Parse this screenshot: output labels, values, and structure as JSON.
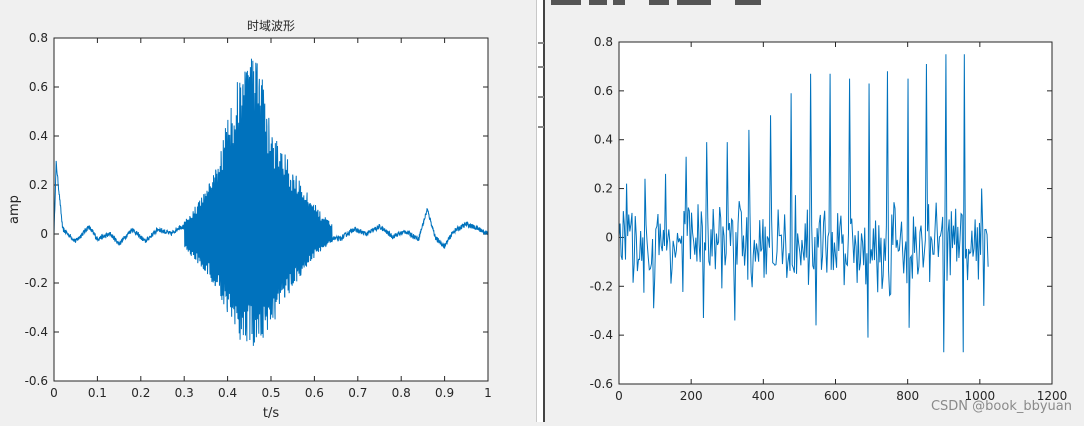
{
  "watermark": "CSDN @book_bbyuan",
  "chart_data": [
    {
      "type": "line",
      "title": "时域波形",
      "xlabel": "t/s",
      "ylabel": "amp",
      "xlim": [
        0,
        1
      ],
      "ylim": [
        -0.6,
        0.8
      ],
      "xticks": [
        0,
        0.1,
        0.2,
        0.3,
        0.4,
        0.5,
        0.6,
        0.7,
        0.8,
        0.9,
        1
      ],
      "yticks": [
        -0.6,
        -0.4,
        -0.2,
        0,
        0.2,
        0.4,
        0.6,
        0.8
      ],
      "xtick_labels": [
        "0",
        "0.1",
        "0.2",
        "0.3",
        "0.4",
        "0.5",
        "0.6",
        "0.7",
        "0.8",
        "0.9",
        "1"
      ],
      "ytick_labels": [
        "-0.6",
        "-0.4",
        "-0.2",
        "0",
        "0.2",
        "0.4",
        "0.6",
        "0.8"
      ],
      "grid": false,
      "color": "#0072bd",
      "envelope": {
        "t": [
          0.3,
          0.32,
          0.35,
          0.38,
          0.4,
          0.42,
          0.44,
          0.46,
          0.48,
          0.5,
          0.52,
          0.55,
          0.58,
          0.61,
          0.64
        ],
        "upper": [
          0.05,
          0.1,
          0.18,
          0.3,
          0.48,
          0.62,
          0.72,
          0.75,
          0.66,
          0.42,
          0.36,
          0.28,
          0.18,
          0.1,
          0.04
        ],
        "lower": [
          -0.05,
          -0.1,
          -0.16,
          -0.24,
          -0.34,
          -0.42,
          -0.46,
          -0.48,
          -0.44,
          -0.38,
          -0.32,
          -0.22,
          -0.14,
          -0.08,
          -0.03
        ]
      },
      "baseline": {
        "t": [
          0.0,
          0.005,
          0.02,
          0.05,
          0.08,
          0.1,
          0.13,
          0.15,
          0.18,
          0.21,
          0.24,
          0.27,
          0.29,
          0.66,
          0.69,
          0.72,
          0.75,
          0.78,
          0.81,
          0.84,
          0.86,
          0.88,
          0.9,
          0.92,
          0.95,
          0.98,
          1.0
        ],
        "y": [
          0.0,
          0.29,
          0.02,
          -0.03,
          0.03,
          -0.02,
          0.0,
          -0.04,
          0.02,
          -0.03,
          0.02,
          0.0,
          0.03,
          -0.02,
          0.02,
          0.0,
          0.03,
          -0.01,
          0.01,
          -0.02,
          0.1,
          -0.02,
          -0.05,
          0.01,
          0.04,
          0.02,
          0.0
        ]
      }
    },
    {
      "type": "line",
      "title": "",
      "xlabel": "",
      "ylabel": "",
      "xlim": [
        0,
        1200
      ],
      "ylim": [
        -0.6,
        0.8
      ],
      "xticks": [
        0,
        200,
        400,
        600,
        800,
        1000,
        1200
      ],
      "yticks": [
        -0.6,
        -0.4,
        -0.2,
        0,
        0.2,
        0.4,
        0.6,
        0.8
      ],
      "xtick_labels": [
        "0",
        "200",
        "400",
        "600",
        "800",
        "1000",
        "1200"
      ],
      "ytick_labels": [
        "-0.6",
        "-0.4",
        "-0.2",
        "0",
        "0.2",
        "0.4",
        "0.6",
        "0.8"
      ],
      "grid": false,
      "color": "#0072bd",
      "n_samples": 1024,
      "peaks": [
        {
          "x": 20,
          "y": 0.22
        },
        {
          "x": 72,
          "y": 0.24
        },
        {
          "x": 128,
          "y": 0.26
        },
        {
          "x": 185,
          "y": 0.33
        },
        {
          "x": 242,
          "y": 0.39
        },
        {
          "x": 300,
          "y": 0.39
        },
        {
          "x": 360,
          "y": 0.44
        },
        {
          "x": 420,
          "y": 0.5
        },
        {
          "x": 476,
          "y": 0.59
        },
        {
          "x": 530,
          "y": 0.67
        },
        {
          "x": 585,
          "y": 0.67
        },
        {
          "x": 640,
          "y": 0.65
        },
        {
          "x": 693,
          "y": 0.63
        },
        {
          "x": 745,
          "y": 0.68
        },
        {
          "x": 800,
          "y": 0.65
        },
        {
          "x": 852,
          "y": 0.71
        },
        {
          "x": 905,
          "y": 0.75
        },
        {
          "x": 958,
          "y": 0.75
        },
        {
          "x": 1005,
          "y": 0.2
        }
      ],
      "troughs": [
        {
          "x": 95,
          "y": -0.29
        },
        {
          "x": 235,
          "y": -0.33
        },
        {
          "x": 320,
          "y": -0.34
        },
        {
          "x": 545,
          "y": -0.36
        },
        {
          "x": 690,
          "y": -0.41
        },
        {
          "x": 805,
          "y": -0.37
        },
        {
          "x": 900,
          "y": -0.47
        },
        {
          "x": 955,
          "y": -0.47
        },
        {
          "x": 1010,
          "y": -0.28
        }
      ]
    }
  ]
}
